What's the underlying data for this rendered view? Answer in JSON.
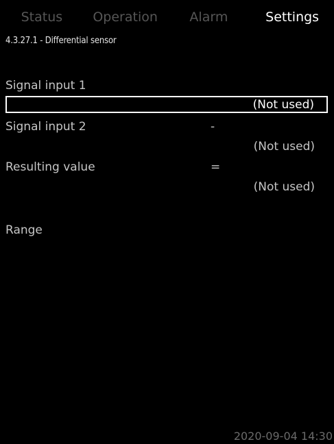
{
  "tabs": [
    {
      "label": "Status",
      "active": false
    },
    {
      "label": "Operation",
      "active": false
    },
    {
      "label": "Alarm",
      "active": false
    },
    {
      "label": "Settings",
      "active": true
    }
  ],
  "breadcrumb": "4.3.27.1 - Differential sensor",
  "signal_input_1": {
    "label": "Signal input 1",
    "value": "(Not used)"
  },
  "signal_input_2": {
    "label": "Signal input 2",
    "operator": "-",
    "value": "(Not used)"
  },
  "resulting_value": {
    "label": "Resulting value",
    "operator": "=",
    "value": "(Not used)"
  },
  "range": {
    "label": "Range"
  },
  "footer": {
    "timestamp": "2020-09-04 14:30"
  },
  "colors": {
    "background": "#000000",
    "active_tab": "#ffffff",
    "inactive_tab": "#565656",
    "text": "#c6c6c6"
  }
}
